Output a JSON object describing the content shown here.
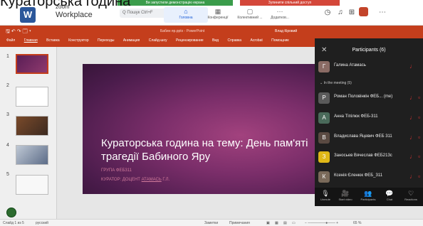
{
  "overlay": {
    "title": "Кураторська година"
  },
  "zoom": {
    "brand_top": "zoom",
    "brand_name": "Workplace",
    "green_notice": "Ви запустили демонстрацію екрана",
    "red_notice": "Зупинити спільний доступ",
    "search_placeholder": "Q Пошук    Ctrl+F",
    "tabs": [
      {
        "label": "Головна"
      },
      {
        "label": "Конференції"
      },
      {
        "label": "Колективний ..."
      },
      {
        "label": "Додатков..."
      }
    ]
  },
  "powerpoint": {
    "quick_icons": "🖫 ↶ ↷ 🗔 ▾",
    "filename": "Бабин яр.pptx  -  PowerPoint",
    "user": "Влад Кіровий",
    "menu": [
      "Файл",
      "Главная",
      "Вставка",
      "Конструктор",
      "Переходы",
      "Анимация",
      "Слайд-шоу",
      "Рецензирование",
      "Вид",
      "Справка",
      "Acrobat",
      "Помощник"
    ],
    "thumb_numbers": [
      "1",
      "2",
      "3",
      "4",
      "5"
    ],
    "slide": {
      "title": "Кураторська година на тему: День пам'яті  трагедії Бабиного Яру",
      "subtitle1": "ГРУПА ФЕБ311",
      "subtitle2_prefix": "КУРАТОР: ДОЦЕНТ ",
      "subtitle2_underlined": "АТАМАСЬ",
      "subtitle2_suffix": " Г.Л."
    },
    "status": {
      "slide_info": "Слайд 1 из 5",
      "language": "русский",
      "notes": "Заметки",
      "comments": "Примечания",
      "zoom": "65 %"
    }
  },
  "participants": {
    "title": "Participants (6)",
    "host": {
      "initial": "Г",
      "name": "Галина Атамась",
      "color": "#8a6b64"
    },
    "in_meeting_label": "In the meeting (5)",
    "list": [
      {
        "initial": "Р",
        "name": "Роман Половінкін ФЕБ... (me)",
        "color": "#5a5a5a"
      },
      {
        "initial": "А",
        "name": "Анна Тіпілюк ФЕБ-311",
        "color": "#4a6a5a"
      },
      {
        "initial": "В",
        "name": "Владислава Яцевич ФЕБ 311",
        "color": "#5a4a42"
      },
      {
        "initial": "З",
        "name": "Заносьев Вячеслав ФЕБ213с",
        "color": "#e0b817"
      },
      {
        "initial": "К",
        "name": "Ксенія Єленюк ФЕБ_311",
        "color": "#7a6a5a"
      }
    ],
    "toolbar": [
      {
        "icon": "🎙",
        "label": "Unmute"
      },
      {
        "icon": "🎥",
        "label": "Start video"
      },
      {
        "icon": "👥",
        "label": "Participants"
      },
      {
        "icon": "💬",
        "label": "Chat"
      },
      {
        "icon": "♡",
        "label": "Reactions"
      }
    ]
  }
}
